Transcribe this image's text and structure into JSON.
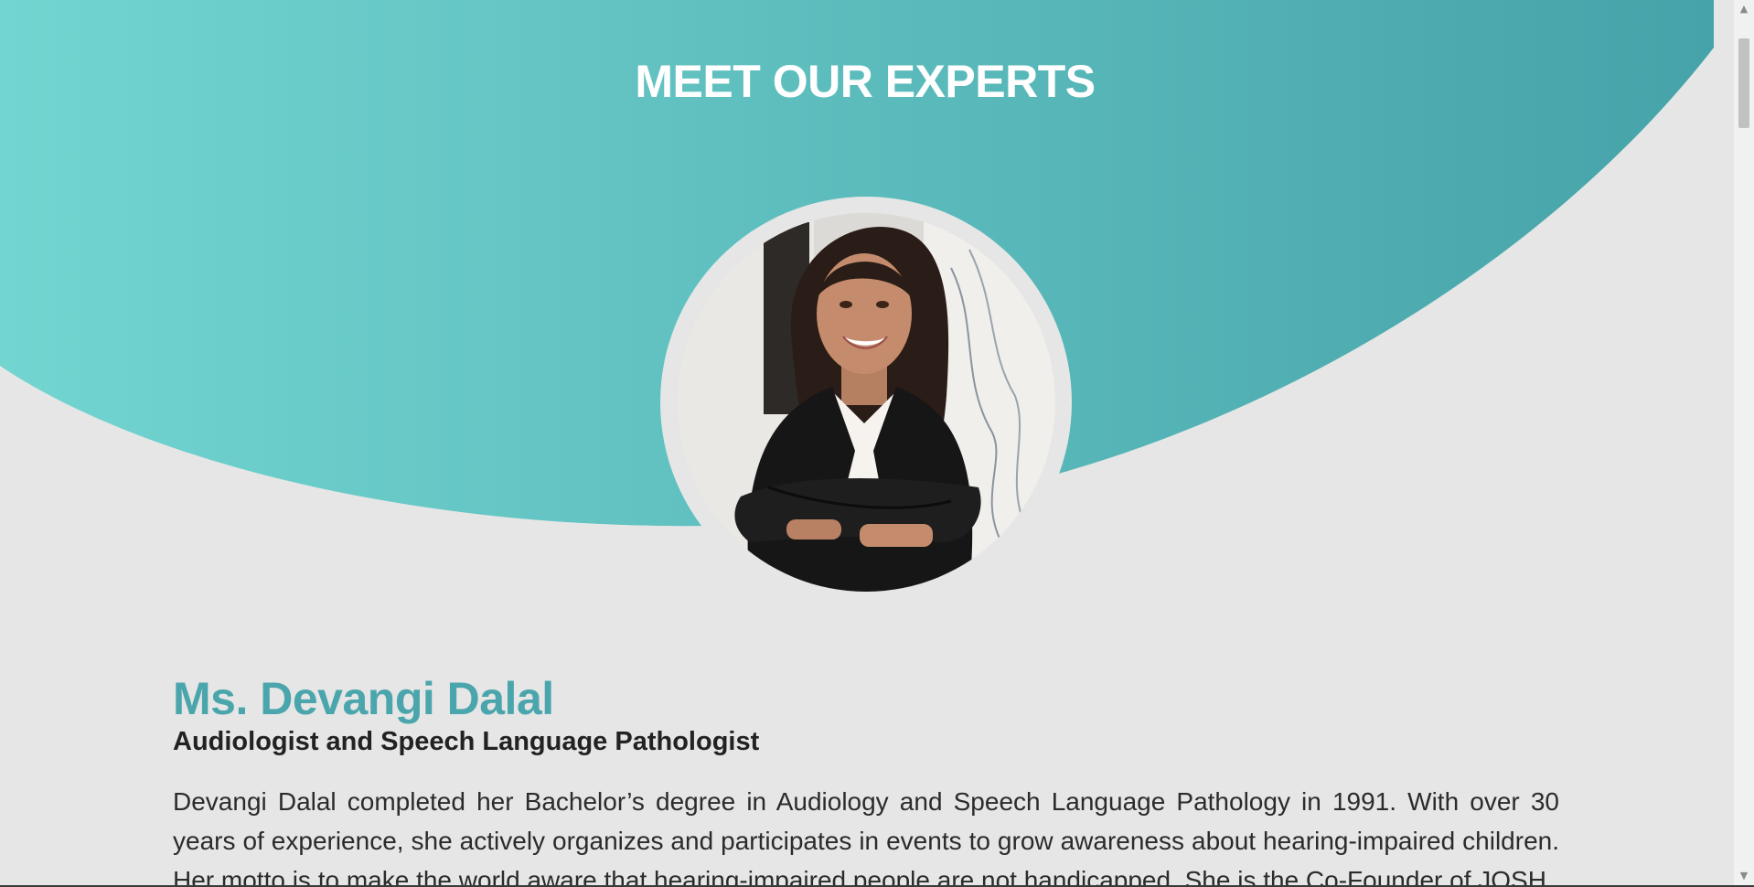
{
  "section": {
    "title": "MEET OUR EXPERTS"
  },
  "expert": {
    "name": "Ms. Devangi Dalal",
    "role": "Audiologist and Speech Language Pathologist",
    "bio": "Devangi Dalal completed her Bachelor’s degree in Audiology and Speech Language Pathology in 1991. With over 30 years of experience, she actively organizes and participates in events to grow awareness about hearing-impaired children. Her motto is to make the world aware that hearing-impaired people are not handicapped. She is the Co-Founder of JOSH"
  },
  "scrollbar": {
    "up_icon": "▲",
    "down_icon": "▼"
  },
  "colors": {
    "teal_light": "#72d5d0",
    "teal_dark": "#46a3a9",
    "background": "#e6e6e6",
    "name_accent": "#4aa6ac"
  }
}
